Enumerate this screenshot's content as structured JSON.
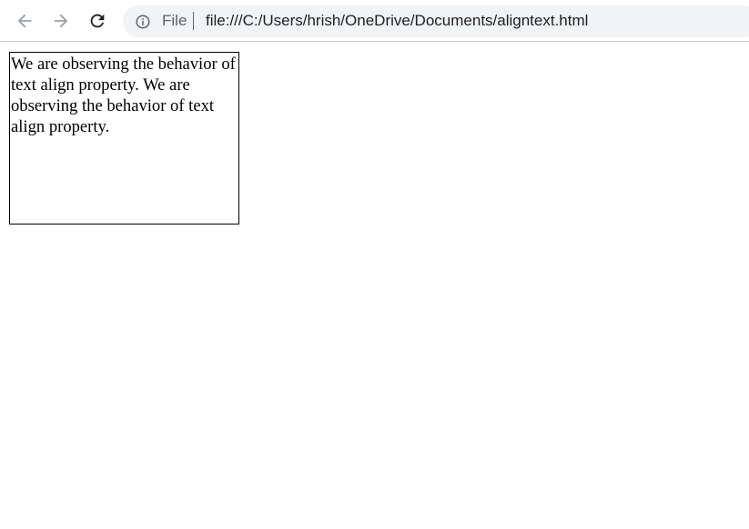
{
  "browser": {
    "back_icon": "arrow-left-icon",
    "forward_icon": "arrow-right-icon",
    "reload_icon": "reload-icon",
    "info_icon": "info-circle-icon",
    "scheme_label": "File",
    "url": "file:///C:/Users/hrish/OneDrive/Documents/aligntext.html"
  },
  "page": {
    "box_text": "We are observing the behavior of text align property. We are observing the behavior of text align property."
  },
  "colors": {
    "toolbar_bg": "#ffffff",
    "omnibox_bg": "#f1f3f4",
    "icon_color": "#5f6368",
    "box_border": "#000000"
  }
}
